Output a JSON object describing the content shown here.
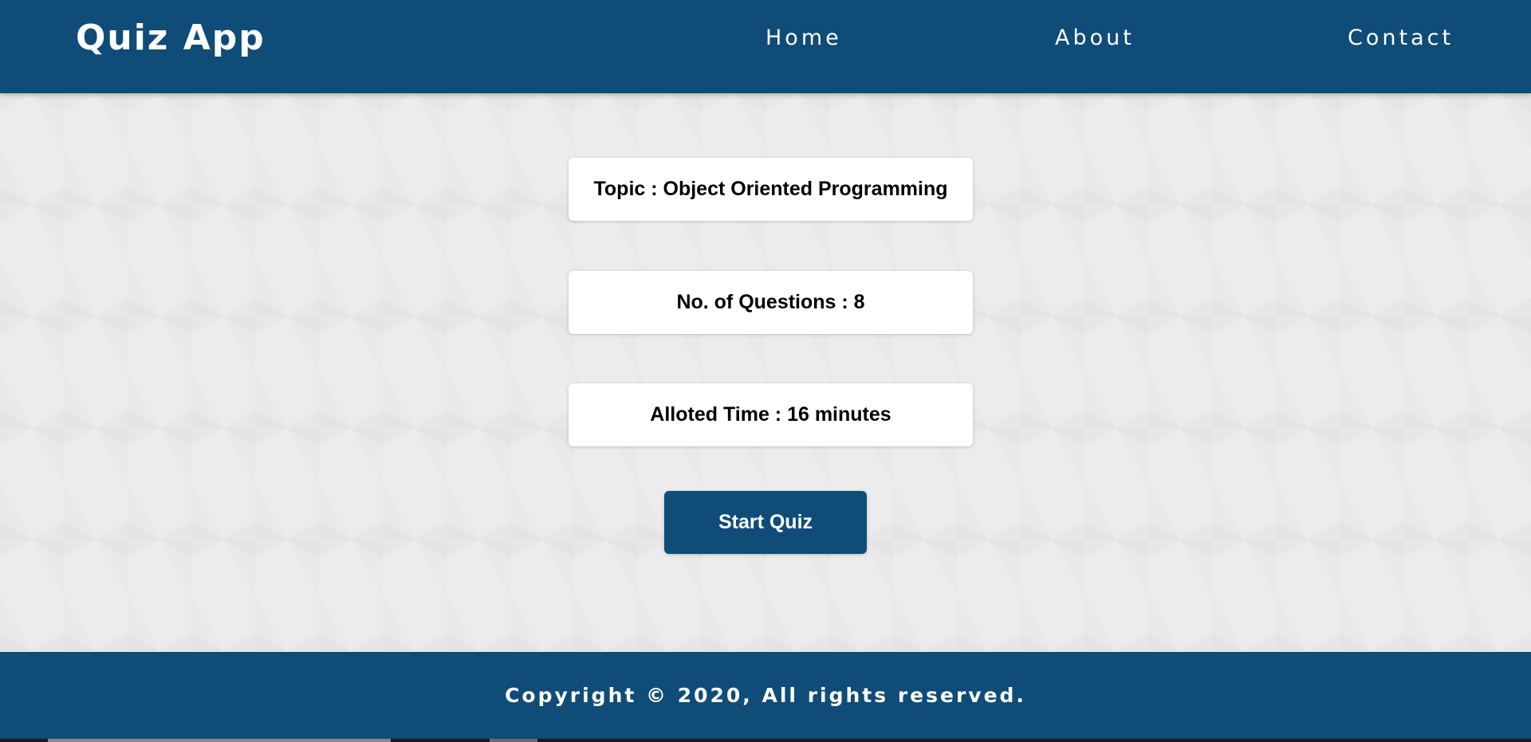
{
  "colors": {
    "primary": "#0f4c77",
    "background": "#ececec",
    "card": "#ffffff"
  },
  "header": {
    "brand": "Quiz App",
    "nav": {
      "home": "Home",
      "about": "About",
      "contact": "Contact"
    }
  },
  "main": {
    "topic": "Topic : Object Oriented Programming",
    "questions": "No. of Questions : 8",
    "time": "Alloted Time : 16 minutes",
    "start_label": "Start Quiz"
  },
  "footer": {
    "copyright": "Copyright © 2020, All rights reserved."
  }
}
